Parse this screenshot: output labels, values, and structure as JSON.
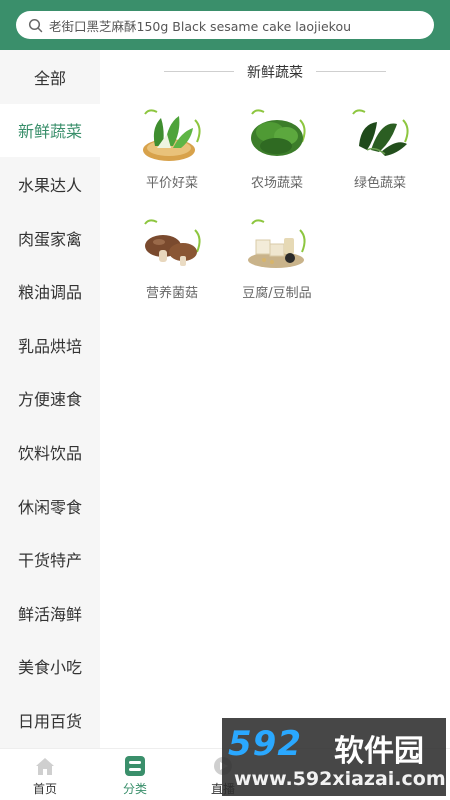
{
  "search": {
    "text": "老街口黑芝麻酥150g Black sesame cake laojiekou"
  },
  "sidebar": {
    "items": [
      {
        "label": "全部"
      },
      {
        "label": "新鲜蔬菜"
      },
      {
        "label": "水果达人"
      },
      {
        "label": "肉蛋家禽"
      },
      {
        "label": "粮油调品"
      },
      {
        "label": "乳品烘培"
      },
      {
        "label": "方便速食"
      },
      {
        "label": "饮料饮品"
      },
      {
        "label": "休闲零食"
      },
      {
        "label": "干货特产"
      },
      {
        "label": "鲜活海鲜"
      },
      {
        "label": "美食小吃"
      },
      {
        "label": "日用百货"
      }
    ],
    "active_index": 1
  },
  "section": {
    "title": "新鲜蔬菜",
    "categories": [
      {
        "label": "平价好菜",
        "icon": "bok-choy-icon"
      },
      {
        "label": "农场蔬菜",
        "icon": "greens-icon"
      },
      {
        "label": "绿色蔬菜",
        "icon": "spinach-icon"
      },
      {
        "label": "营养菌菇",
        "icon": "mushroom-icon"
      },
      {
        "label": "豆腐/豆制品",
        "icon": "tofu-icon"
      }
    ]
  },
  "tabbar": {
    "tabs": [
      {
        "label": "首页",
        "icon": "home-icon"
      },
      {
        "label": "分类",
        "icon": "category-icon"
      },
      {
        "label": "直播",
        "icon": "live-icon"
      }
    ],
    "active_index": 1
  },
  "watermark": {
    "logo": "592",
    "name": "软件园",
    "url": "www.592xiazai.com"
  },
  "colors": {
    "brand": "#3a8f6b",
    "sidebar_bg": "#f6f6f6",
    "accent_leaf": "#8dc63f"
  }
}
